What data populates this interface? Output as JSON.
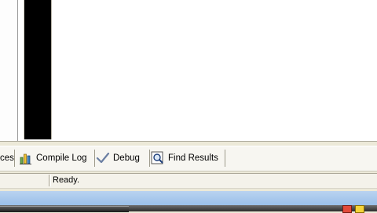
{
  "tabs": [
    {
      "label": "ces",
      "icon": "resources-icon"
    },
    {
      "label": "Compile Log",
      "icon": "bar-chart-icon"
    },
    {
      "label": "Debug",
      "icon": "checkmark-icon"
    },
    {
      "label": "Find Results",
      "icon": "magnifier-icon"
    }
  ],
  "status": {
    "text": "Ready."
  },
  "colors": {
    "accent_blue": "#97bde8",
    "tray_red": "#e24a3a",
    "tray_yellow": "#f4d33a"
  }
}
